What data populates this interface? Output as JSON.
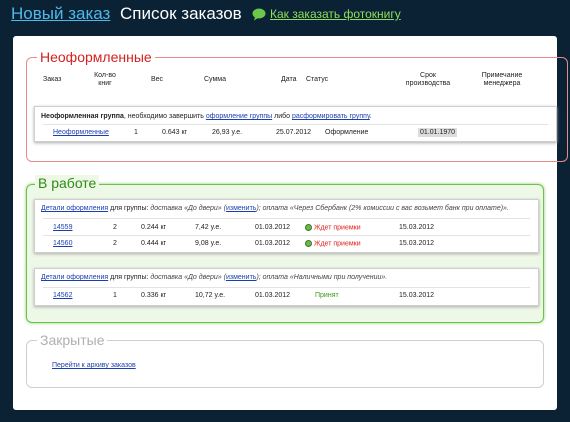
{
  "nav": {
    "new_order": "Новый заказ",
    "orders_list": "Список заказов",
    "how_to_order": "Как заказать фотокнигу"
  },
  "unfinished": {
    "title": "Неоформленные",
    "headers": {
      "order": "Заказ",
      "qty": "Кол-во книг",
      "weight": "Вес",
      "sum": "Сумма",
      "date": "Дата",
      "status": "Статус",
      "term": "Срок производства",
      "note": "Примечание менеджера"
    },
    "group_text_1": "Неоформленная группа",
    "group_text_2": ", необходимо завершить ",
    "group_link_1": "оформление группы",
    "group_text_3": " либо ",
    "group_link_2": "расформировать группу",
    "group_text_4": ".",
    "row": {
      "order": "Неоформленные",
      "qty": "1",
      "weight": "0.643 кг",
      "sum": "26,93 у.е.",
      "date": "25.07.2012",
      "status": "Оформление",
      "term": "01.01.1970"
    }
  },
  "in_work": {
    "title": "В работе",
    "groups": [
      {
        "details": "Детали оформления",
        "text_a": " для группы: ",
        "delivery": "доставка «До двери» (",
        "change": "изменить",
        "text_b": "); оплата «Через Сбербанк (2% комиссии с вас возьмет банк при оплате)».",
        "rows": [
          {
            "order": "14559",
            "qty": "2",
            "weight": "0.244 кг",
            "sum": "7,42 у.е.",
            "date": "01.03.2012",
            "status": "Ждет приемки",
            "term": "15.03.2012"
          },
          {
            "order": "14560",
            "qty": "2",
            "weight": "0.444 кг",
            "sum": "9,08 у.е.",
            "date": "01.03.2012",
            "status": "Ждет приемки",
            "term": "15.03.2012"
          }
        ]
      },
      {
        "details": "Детали оформления",
        "text_a": " для группы: ",
        "delivery": "доставка «До двери» (",
        "change": "изменить",
        "text_b": "); оплата «Наличными при получении».",
        "rows": [
          {
            "order": "14562",
            "qty": "1",
            "weight": "0.336 кг",
            "sum": "10,72 у.е.",
            "date": "01.03.2012",
            "status": "Принят",
            "term": "15.03.2012"
          }
        ]
      }
    ]
  },
  "closed": {
    "title": "Закрытые",
    "archive_link": "Перейти к архиву заказов"
  },
  "colors": {
    "background": "#0b2234",
    "red_border": "#e88a8a",
    "green_border": "#6ac24a",
    "link": "#1a3fb0"
  }
}
